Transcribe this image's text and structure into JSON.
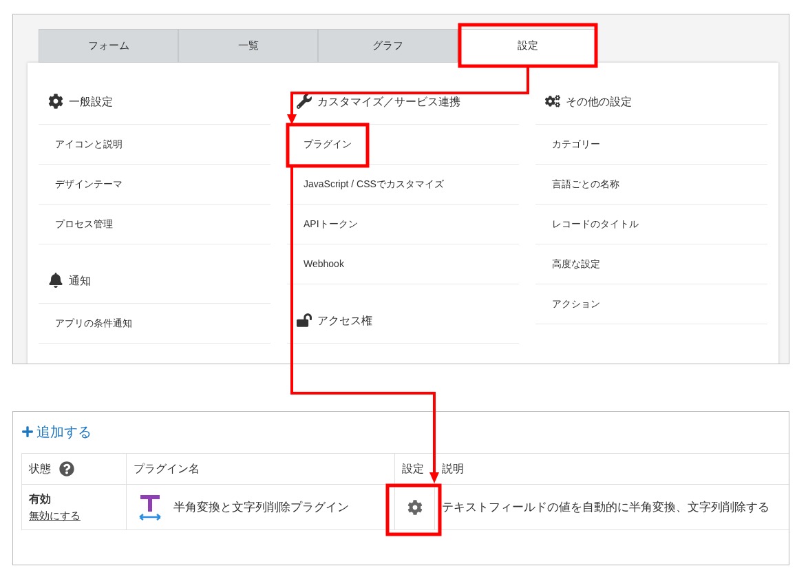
{
  "tabs": [
    {
      "label": "フォーム",
      "selected": false
    },
    {
      "label": "一覧",
      "selected": false
    },
    {
      "label": "グラフ",
      "selected": false
    },
    {
      "label": "設定",
      "selected": true
    }
  ],
  "settings_columns": [
    {
      "sections": [
        {
          "title": "一般設定",
          "items": [
            "アイコンと説明",
            "デザインテーマ",
            "プロセス管理"
          ]
        },
        {
          "title": "通知",
          "items": [
            "アプリの条件通知"
          ]
        }
      ]
    },
    {
      "sections": [
        {
          "title": "カスタマイズ／サービス連携",
          "items": [
            "プラグイン",
            "JavaScript / CSSでカスタマイズ",
            "APIトークン",
            "Webhook"
          ]
        },
        {
          "title": "アクセス権"
        }
      ]
    },
    {
      "sections": [
        {
          "title": "その他の設定",
          "items": [
            "カテゴリー",
            "言語ごとの名称",
            "レコードのタイトル",
            "高度な設定",
            "アクション"
          ]
        }
      ]
    }
  ],
  "plugins": {
    "add_button": "追加する",
    "columns": [
      "状態",
      "プラグイン名",
      "設定",
      "説明"
    ],
    "rows": [
      {
        "status": "有効",
        "toggle_link": "無効にする",
        "name": "半角変換と文字列削除プラグイン",
        "description": "テキストフィールドの値を自動的に半角変換、文字列削除する"
      }
    ]
  }
}
